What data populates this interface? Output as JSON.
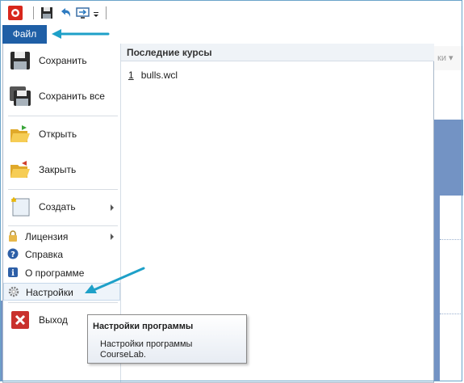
{
  "toolbar": {
    "icons": [
      "app-icon",
      "save-icon",
      "undo-icon",
      "screen-icon",
      "dropdown-arrow-icon"
    ]
  },
  "file_tab": {
    "label": "Файл"
  },
  "menu": {
    "items_big": [
      {
        "label": "Сохранить",
        "icon": "save-icon"
      },
      {
        "label": "Сохранить все",
        "icon": "save-all-icon"
      },
      {
        "label": "Открыть",
        "icon": "open-folder-icon"
      },
      {
        "label": "Закрыть",
        "icon": "close-folder-icon"
      },
      {
        "label": "Создать",
        "icon": "new-document-icon",
        "submenu": true
      }
    ],
    "items_small": [
      {
        "label": "Лицензия",
        "icon": "lock-icon",
        "submenu": true
      },
      {
        "label": "Справка",
        "icon": "help-icon"
      },
      {
        "label": "О программе",
        "icon": "info-icon"
      },
      {
        "label": "Настройки",
        "icon": "gear-icon"
      }
    ],
    "exit": {
      "label": "Выход",
      "icon": "exit-icon"
    }
  },
  "recent": {
    "header": "Последние курсы",
    "items": [
      {
        "num": "1",
        "name": "bulls.wcl"
      }
    ]
  },
  "tooltip": {
    "title": "Настройки программы",
    "body": "Настройки программы CourseLab."
  },
  "background": {
    "ribbon_text": "ки ▾"
  },
  "colors": {
    "accent": "#1f5fa6",
    "annotation": "#1ea0c8",
    "canvas": "#7393c4"
  }
}
